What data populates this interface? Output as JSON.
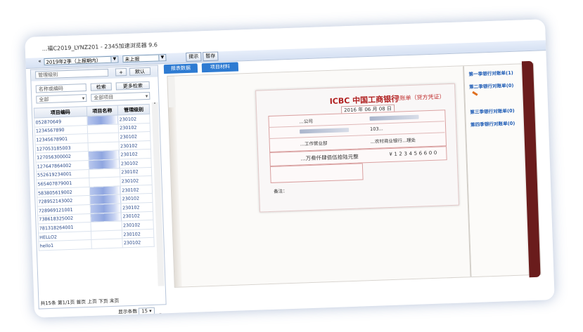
{
  "window": {
    "title": "...福C2019_LYNZ201 - 2345加速浏览器 9.6"
  },
  "toolbar": {
    "period_prefix": "«",
    "period": "2019年2季（上报期内）",
    "status": "未上报",
    "hint_button": "提示",
    "save_button": "暂存"
  },
  "left_panel": {
    "manage_label": "管理级别",
    "plus_button": "+",
    "default_button": "默认",
    "search_placeholder": "名称或编码",
    "search_button": "检索",
    "more_search_button": "更多检索",
    "filter_all": "全部",
    "filter_all_items": "全部项目",
    "columns": [
      "项目编码",
      "项目名称",
      "管理级别"
    ],
    "rows": [
      {
        "code": "052870649",
        "name": "...区...",
        "level": "230102"
      },
      {
        "code": "1234567890",
        "name": "",
        "level": "230102"
      },
      {
        "code": "12345678901",
        "name": "",
        "level": "230102"
      },
      {
        "code": "127053185003",
        "name": "",
        "level": "230102"
      },
      {
        "code": "127056300002",
        "name": "...",
        "level": "230102"
      },
      {
        "code": "127647864002",
        "name": "...器...",
        "level": "230102"
      },
      {
        "code": "552619234001",
        "name": "",
        "level": "230102"
      },
      {
        "code": "565407879001",
        "name": "",
        "level": "230102"
      },
      {
        "code": "583805619002",
        "name": "...地",
        "level": "230102"
      },
      {
        "code": "728952143002",
        "name": "...际",
        "level": "230102"
      },
      {
        "code": "728969121001",
        "name": "...区",
        "level": "230102"
      },
      {
        "code": "738618325002",
        "name": "...7...",
        "level": "230102"
      },
      {
        "code": "781318264001",
        "name": "",
        "level": "230102"
      },
      {
        "code": "HELLO2",
        "name": "",
        "level": "230102"
      },
      {
        "code": "hello1",
        "name": "",
        "level": "230102"
      }
    ],
    "pager_text": "共15条 第1/1页 首页 上页 下页 末页",
    "page_size_label": "显示条数",
    "page_size": "15"
  },
  "tabs": [
    {
      "label": "报表数据"
    },
    {
      "label": "项目材料"
    }
  ],
  "side_links": [
    "第一季银行对账单(1)",
    "第二季银行对账单(0)",
    "第三季银行对账单(0)",
    "第四季银行对账单(0)"
  ],
  "receipt": {
    "bank": "ICBC 中国工商银行",
    "title": "进账单（贷方凭证）",
    "date": "2016 年 06 月 08 日",
    "payer_company": "...公司",
    "payer_bank": "...工作营业部",
    "payee_account": "103...",
    "payee_bank": "...农村商业银行...理处",
    "amount_words": "...万叁仟肆佰伍拾陆元整",
    "amount_digits": "¥123456600",
    "note_label": "备注："
  }
}
